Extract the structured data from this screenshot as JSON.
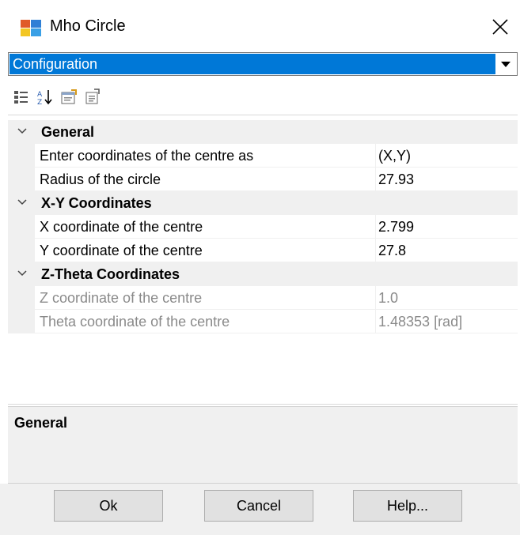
{
  "window": {
    "title": "Mho Circle",
    "icon": "app-window-icon",
    "close_icon": "close-icon"
  },
  "combo": {
    "selected": "Configuration",
    "arrow_icon": "dropdown-arrow-icon"
  },
  "toolbar": {
    "buttons": [
      {
        "icon": "categorized-icon"
      },
      {
        "icon": "alphabetical-sort-icon"
      },
      {
        "icon": "property-pages-icon"
      },
      {
        "icon": "events-icon"
      }
    ]
  },
  "grid": {
    "categories": [
      {
        "label": "General",
        "properties": [
          {
            "name": "Enter coordinates of the centre as",
            "value": "(X,Y)",
            "enabled": true
          },
          {
            "name": "Radius of the circle",
            "value": "27.93",
            "enabled": true
          }
        ]
      },
      {
        "label": "X-Y Coordinates",
        "properties": [
          {
            "name": "X coordinate of the centre",
            "value": "2.799",
            "enabled": true
          },
          {
            "name": "Y coordinate of the centre",
            "value": "27.8",
            "enabled": true
          }
        ]
      },
      {
        "label": "Z-Theta Coordinates",
        "properties": [
          {
            "name": "Z coordinate of the centre",
            "value": "1.0",
            "enabled": false
          },
          {
            "name": "Theta coordinate of the centre",
            "value": "1.48353 [rad]",
            "enabled": false
          }
        ]
      }
    ]
  },
  "description": {
    "title": "General"
  },
  "buttons": {
    "ok": "Ok",
    "cancel": "Cancel",
    "help": "Help..."
  },
  "colors": {
    "selection": "#0078d7",
    "category_bg": "#f0f0f0",
    "disabled_text": "#8a8a8a"
  }
}
